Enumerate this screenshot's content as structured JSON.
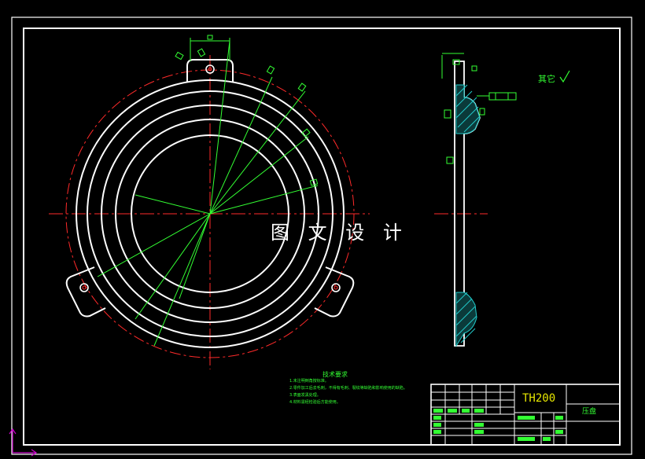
{
  "watermark": "图 文 设 计",
  "title_block": {
    "drawing_code": "TH200",
    "part_name": "压盘"
  },
  "roughness_note": "其它",
  "tech_requirements": {
    "title": "技术要求",
    "items": [
      "1.未注明倒角按标准。",
      "2.零件加工后去毛刺，不得有毛刺、裂纹等缺陷和影响使用的缺陷。",
      "3.表面发黑处理。",
      "4.材料需经检验后方能使用。"
    ]
  },
  "colors": {
    "outline": "#ffffff",
    "centerline": "#ff2a2a",
    "dimension": "#33ff33",
    "hatch": "#22cccc",
    "axis_marker": "#cc00cc"
  }
}
